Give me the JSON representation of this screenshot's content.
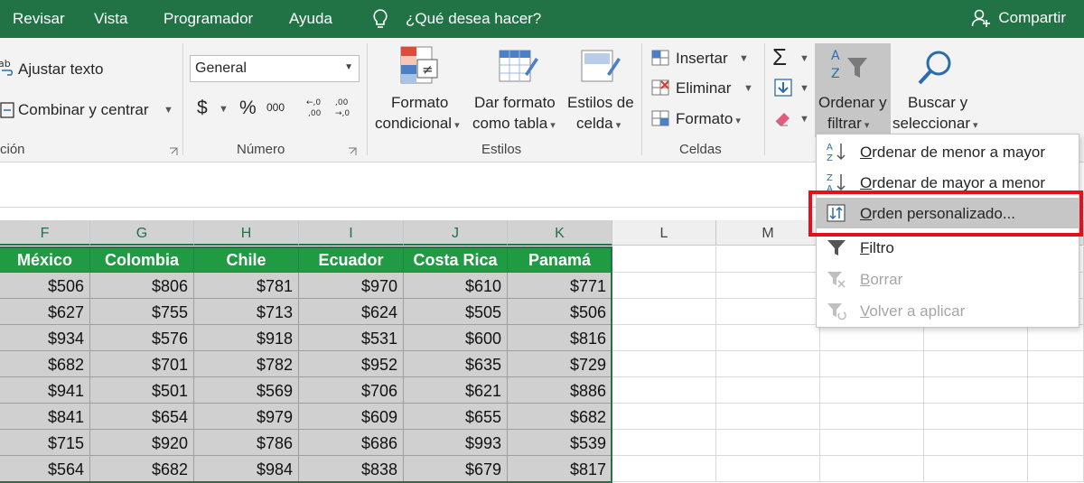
{
  "menubar": {
    "tabs": [
      "Revisar",
      "Vista",
      "Programador",
      "Ayuda"
    ],
    "tell_me": "¿Qué desea hacer?",
    "share": "Compartir"
  },
  "alignment_group": {
    "wrap_text": "Ajustar texto",
    "merge_center": "Combinar y centrar",
    "label_partial": "ción"
  },
  "number_group": {
    "format_value": "General",
    "currency": "$",
    "percent": "%",
    "thousands": "000",
    "inc_decimal": "←,0 ,00",
    "dec_decimal": ",00 →,0",
    "label": "Número"
  },
  "styles_group": {
    "cond_format": [
      "Formato",
      "condicional"
    ],
    "format_table": [
      "Dar formato",
      "como tabla"
    ],
    "cell_styles": [
      "Estilos de",
      "celda"
    ],
    "label": "Estilos"
  },
  "cells_group": {
    "insert": "Insertar",
    "delete": "Eliminar",
    "format": "Formato",
    "label": "Celdas"
  },
  "editing_group": {
    "sort_filter": [
      "Ordenar y",
      "filtrar"
    ],
    "find_select": [
      "Buscar y",
      "seleccionar"
    ]
  },
  "dropdown": {
    "items": [
      {
        "label": "Ordenar de menor a mayor",
        "underline": "O",
        "rest": "rdenar de menor a mayor",
        "icon": "sort-az-icon",
        "state": "normal"
      },
      {
        "label": "Ordenar de mayor a menor",
        "underline": "O",
        "rest": "rdenar de mayor a menor",
        "icon": "sort-za-icon",
        "state": "normal"
      },
      {
        "label": "Orden personalizado...",
        "underline": "O",
        "rest": "rden personalizado...",
        "icon": "custom-sort-icon",
        "state": "highlighted"
      },
      {
        "label": "Filtro",
        "underline": "F",
        "rest": "iltro",
        "icon": "filter-icon",
        "state": "normal"
      },
      {
        "label": "Borrar",
        "underline": "B",
        "rest": "orrar",
        "icon": "clear-filter-icon",
        "state": "disabled"
      },
      {
        "label": "Volver a aplicar",
        "underline": "V",
        "rest": "olver a aplicar",
        "icon": "reapply-icon",
        "state": "disabled"
      }
    ]
  },
  "grid": {
    "columns": [
      "F",
      "G",
      "H",
      "I",
      "J",
      "K",
      "L",
      "M"
    ],
    "headers": [
      "México",
      "Colombia",
      "Chile",
      "Ecuador",
      "Costa Rica",
      "Panamá"
    ],
    "rows": [
      [
        "$506",
        "$806",
        "$781",
        "$970",
        "$610",
        "$771"
      ],
      [
        "$627",
        "$755",
        "$713",
        "$624",
        "$505",
        "$506"
      ],
      [
        "$934",
        "$576",
        "$918",
        "$531",
        "$600",
        "$816"
      ],
      [
        "$682",
        "$701",
        "$782",
        "$952",
        "$635",
        "$729"
      ],
      [
        "$941",
        "$501",
        "$569",
        "$706",
        "$621",
        "$886"
      ],
      [
        "$841",
        "$654",
        "$979",
        "$609",
        "$655",
        "$682"
      ],
      [
        "$715",
        "$920",
        "$786",
        "$686",
        "$993",
        "$539"
      ],
      [
        "$564",
        "$682",
        "$984",
        "$838",
        "$679",
        "$817"
      ]
    ]
  },
  "colors": {
    "excel_green": "#217346",
    "header_green": "#219a44",
    "selected_cells": "#d0d0d0",
    "highlight_box": "#e2111b"
  }
}
